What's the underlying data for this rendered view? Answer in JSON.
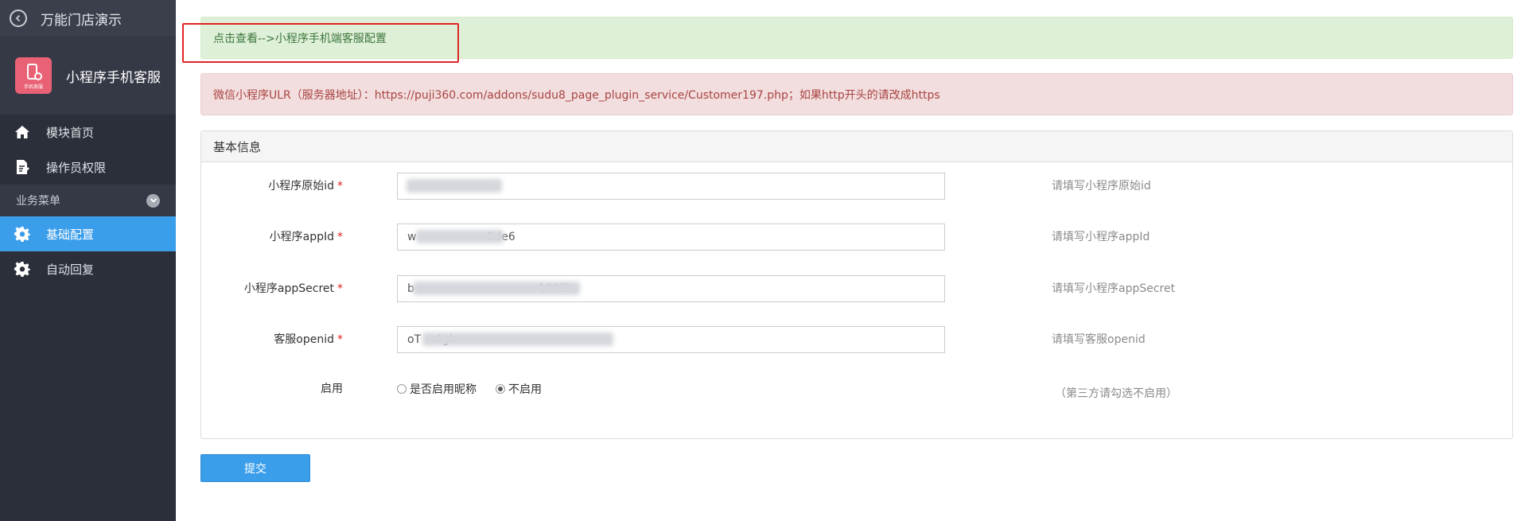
{
  "sidebar": {
    "back_title": "万能门店演示",
    "module": {
      "logo_caption": "手机客服",
      "name": "小程序手机客服"
    },
    "items": [
      {
        "label": "模块首页",
        "icon": "home-icon",
        "active": false
      },
      {
        "label": "操作员权限",
        "icon": "document-edit-icon",
        "active": false
      }
    ],
    "section": {
      "label": "业务菜单",
      "icon": "chevron-down-icon"
    },
    "business_items": [
      {
        "label": "基础配置",
        "icon": "gear-icon",
        "active": true
      },
      {
        "label": "自动回复",
        "icon": "gear-icon",
        "active": false
      }
    ]
  },
  "alerts": {
    "success": "点击查看-->小程序手机端客服配置",
    "danger": "微信小程序ULR（服务器地址）：https://puji360.com/addons/sudu8_page_plugin_service/Customer197.php；如果http开头的请改成https"
  },
  "panel": {
    "title": "基本信息",
    "fields": [
      {
        "label": "小程序原始id",
        "required": "*",
        "value": "",
        "help": "请填写小程序原始id"
      },
      {
        "label": "小程序appId",
        "required": "*",
        "value": "w                    5de6",
        "help": "请填写小程序appId"
      },
      {
        "label": "小程序appSecret",
        "required": "*",
        "value": "b                                   160f2",
        "help": "请填写小程序appSecret"
      },
      {
        "label": "客服openid",
        "required": "*",
        "value": "oT    4gh",
        "help": "请填写客服openid"
      }
    ],
    "enable": {
      "label": "启用",
      "options": [
        {
          "label": "是否启用昵称",
          "checked": false
        },
        {
          "label": "不启用",
          "checked": true
        }
      ],
      "help": "（第三方请勾选不启用）"
    }
  },
  "submit_label": "提交",
  "colors": {
    "sidebar_bg": "#2b2f3a",
    "active_blue": "#3b9eeb",
    "success_bg": "#dff0d8",
    "danger_bg": "#f2dede",
    "highlight_red": "#e02424"
  }
}
